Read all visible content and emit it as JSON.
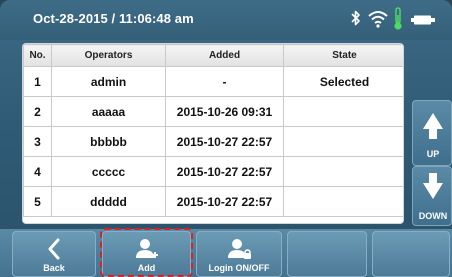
{
  "status_bar": {
    "datetime": "Oct-28-2015 / 11:06:48 am",
    "icons": [
      "bluetooth-icon",
      "wifi-icon",
      "thermometer-icon",
      "battery-icon"
    ],
    "thermometer_color": "#4cd964"
  },
  "table": {
    "headers": {
      "no": "No.",
      "operators": "Operators",
      "added": "Added",
      "state": "State"
    },
    "rows": [
      {
        "no": "1",
        "operator": "admin",
        "added": "-",
        "state": "Selected"
      },
      {
        "no": "2",
        "operator": "aaaaa",
        "added": "2015-10-26 09:31",
        "state": ""
      },
      {
        "no": "3",
        "operator": "bbbbb",
        "added": "2015-10-27 22:57",
        "state": ""
      },
      {
        "no": "4",
        "operator": "ccccc",
        "added": "2015-10-27 22:57",
        "state": ""
      },
      {
        "no": "5",
        "operator": "ddddd",
        "added": "2015-10-27 22:57",
        "state": ""
      }
    ]
  },
  "side": {
    "up_label": "UP",
    "down_label": "DOWN"
  },
  "bottom": {
    "back_label": "Back",
    "add_label": "Add",
    "login_label": "Login ON/OFF",
    "highlight_color": "#e02020"
  }
}
